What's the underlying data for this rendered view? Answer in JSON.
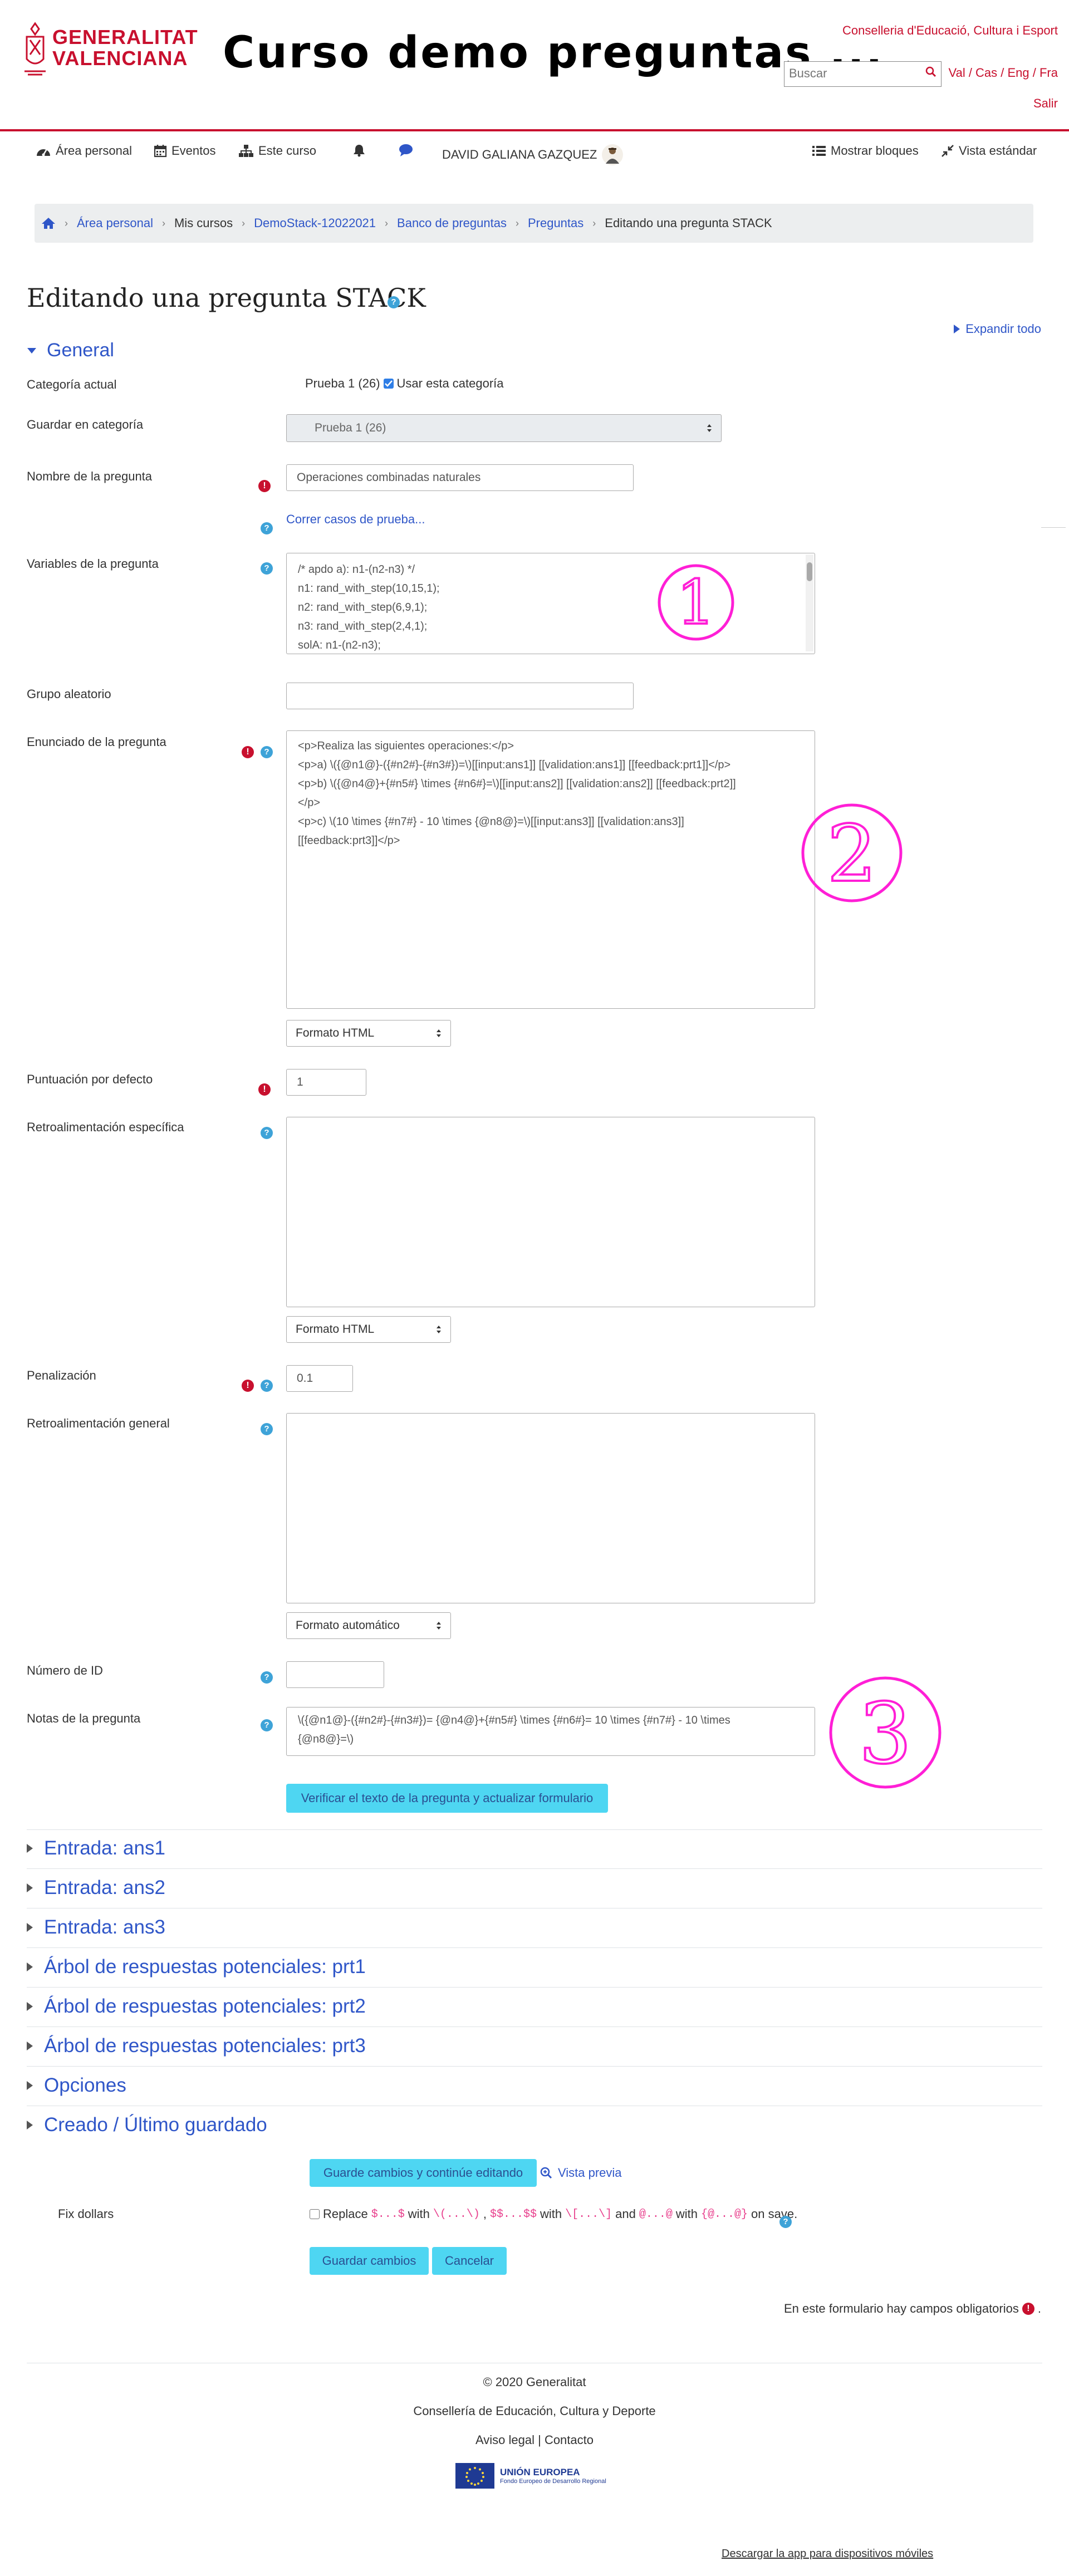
{
  "header": {
    "logo_line1": "GENERALITAT",
    "logo_line2": "VALENCIANA",
    "site_title": "Curso demo preguntas ...",
    "conselleria": "Conselleria d'Educació, Cultura i Esport",
    "search_placeholder": "Buscar",
    "languages": "Val / Cas / Eng / Fra",
    "logout": "Salir"
  },
  "navbar": {
    "personal_area": "Área personal",
    "events": "Eventos",
    "this_course": "Este curso",
    "user_name": "DAVID GALIANA GAZQUEZ",
    "show_blocks": "Mostrar bloques",
    "standard_view": "Vista estándar"
  },
  "breadcrumb": {
    "items": [
      "Área personal",
      "Mis cursos",
      "DemoStack-12022021",
      "Banco de preguntas",
      "Preguntas",
      "Editando una pregunta STACK"
    ]
  },
  "page": {
    "title": "Editando una pregunta STACK",
    "expand_all": "Expandir todo"
  },
  "general": {
    "section_title": "General",
    "current_category_label": "Categoría actual",
    "current_category_value": "Prueba 1 (26)",
    "use_category_label": "Usar esta categoría",
    "save_in_category_label": "Guardar en categoría",
    "save_in_category_value": "Prueba 1 (26)",
    "question_name_label": "Nombre de la pregunta",
    "question_name_value": "Operaciones combinadas naturales",
    "run_tests_link": "Correr casos de prueba...",
    "question_variables_label": "Variables de la pregunta",
    "question_variables_lines": [
      "/* apdo a): n1-(n2-n3) */",
      "n1: rand_with_step(10,15,1);",
      "n2: rand_with_step(6,9,1);",
      "n3: rand_with_step(2,4,1);",
      "solA: n1-(n2-n3);"
    ],
    "random_group_label": "Grupo aleatorio",
    "random_group_value": "",
    "question_text_label": "Enunciado de la pregunta",
    "question_text_lines": [
      "<p>Realiza las siguientes operaciones:</p>",
      "<p>a) \\({@n1@}-({#n2#}-{#n3#})=\\)[[input:ans1]] [[validation:ans1]] [[feedback:prt1]]</p>",
      "<p>b) \\({@n4@}+{#n5#} \\times {#n6#}=\\)[[input:ans2]] [[validation:ans2]] [[feedback:prt2]]",
      "</p>",
      "<p>c) \\(10 \\times {#n7#} - 10 \\times {@n8@}=\\)[[input:ans3]] [[validation:ans3]]",
      "[[feedback:prt3]]</p>"
    ],
    "format_html": "Formato HTML",
    "default_mark_label": "Puntuación por defecto",
    "default_mark_value": "1",
    "specific_feedback_label": "Retroalimentación específica",
    "penalty_label": "Penalización",
    "penalty_value": "0.1",
    "general_feedback_label": "Retroalimentación general",
    "format_auto": "Formato automático",
    "id_number_label": "Número de ID",
    "id_number_value": "",
    "question_note_label": "Notas de la pregunta",
    "question_note_lines": [
      "\\({@n1@}-({#n2#}-{#n3#})=   {@n4@}+{#n5#} \\times {#n6#}=  10 \\times {#n7#} - 10 \\times",
      "{@n8@}=\\)"
    ],
    "verify_button": "Verificar el texto de la pregunta y actualizar formulario"
  },
  "collapsed_sections": [
    "Entrada: ans1",
    "Entrada: ans2",
    "Entrada: ans3",
    "Árbol de respuestas potenciales: prt1",
    "Árbol de respuestas potenciales: prt2",
    "Árbol de respuestas potenciales: prt3",
    "Opciones",
    "Creado / Último guardado"
  ],
  "actions": {
    "save_continue": "Guarde cambios y continúe editando",
    "preview": "Vista previa",
    "fix_dollars_label": "Fix dollars",
    "fix_replace": "Replace",
    "fix_code1": "$...$",
    "fix_with1": "with",
    "fix_code2": "\\(...\\)",
    "fix_code3": "$$...$$",
    "fix_with2": "with",
    "fix_code4": "\\[...\\]",
    "fix_and": "and",
    "fix_code5": "@...@",
    "fix_with3": "with",
    "fix_code6": "{@...@}",
    "fix_on_save": "on save.",
    "save": "Guardar cambios",
    "cancel": "Cancelar",
    "required_note": "En este formulario hay campos obligatorios"
  },
  "footer": {
    "copyright": "© 2020 Generalitat",
    "conselleria": "Consellería de Educación, Cultura y Deporte",
    "legal": "Aviso legal",
    "contact": "Contacto",
    "eu_title": "UNIÓN EUROPEA",
    "eu_subtitle": "Fondo Europeo de Desarrollo Regional",
    "mobile_app": "Descargar la app para dispositivos móviles"
  },
  "annotations": {
    "one": "1",
    "two": "2",
    "three": "3"
  },
  "colors": {
    "brand_red": "#c8102e",
    "link_blue": "#2f56c8",
    "button_cyan": "#4ed6f2",
    "annotation_magenta": "#ff1fd6"
  }
}
